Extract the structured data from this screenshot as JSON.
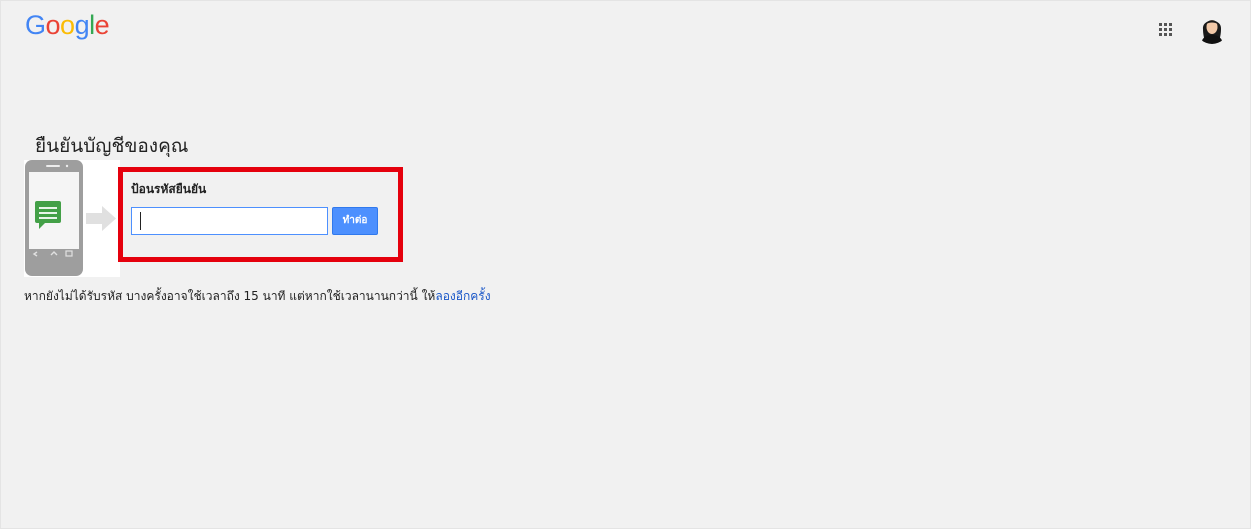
{
  "header": {
    "logo": {
      "letters": [
        {
          "char": "G",
          "color": "#4285f4"
        },
        {
          "char": "o",
          "color": "#ea4335"
        },
        {
          "char": "o",
          "color": "#fbbc05"
        },
        {
          "char": "g",
          "color": "#4285f4"
        },
        {
          "char": "l",
          "color": "#34a853"
        },
        {
          "char": "e",
          "color": "#ea4335"
        }
      ]
    },
    "apps_icon": "apps-grid-icon",
    "avatar_icon": "account-avatar-icon"
  },
  "main": {
    "title": "ยืนยันบัญชีของคุณ",
    "illustration_icon": "phone-sms-arrow-icon",
    "code_label": "ป้อนรหัสยืนยัน",
    "code_input": {
      "value": "",
      "placeholder": ""
    },
    "next_button_label": "ทำต่อ",
    "help_text": "หากยังไม่ได้รับรหัส บางครั้งอาจใช้เวลาถึง 15 นาที แต่หากใช้เวลานานกว่านี้ ให้",
    "retry_link": "ลองอีกครั้ง"
  },
  "colors": {
    "background": "#f1f1f1",
    "accent_blue": "#4d90fe",
    "highlight_red": "#e5000d",
    "link_blue": "#1a57c8"
  }
}
